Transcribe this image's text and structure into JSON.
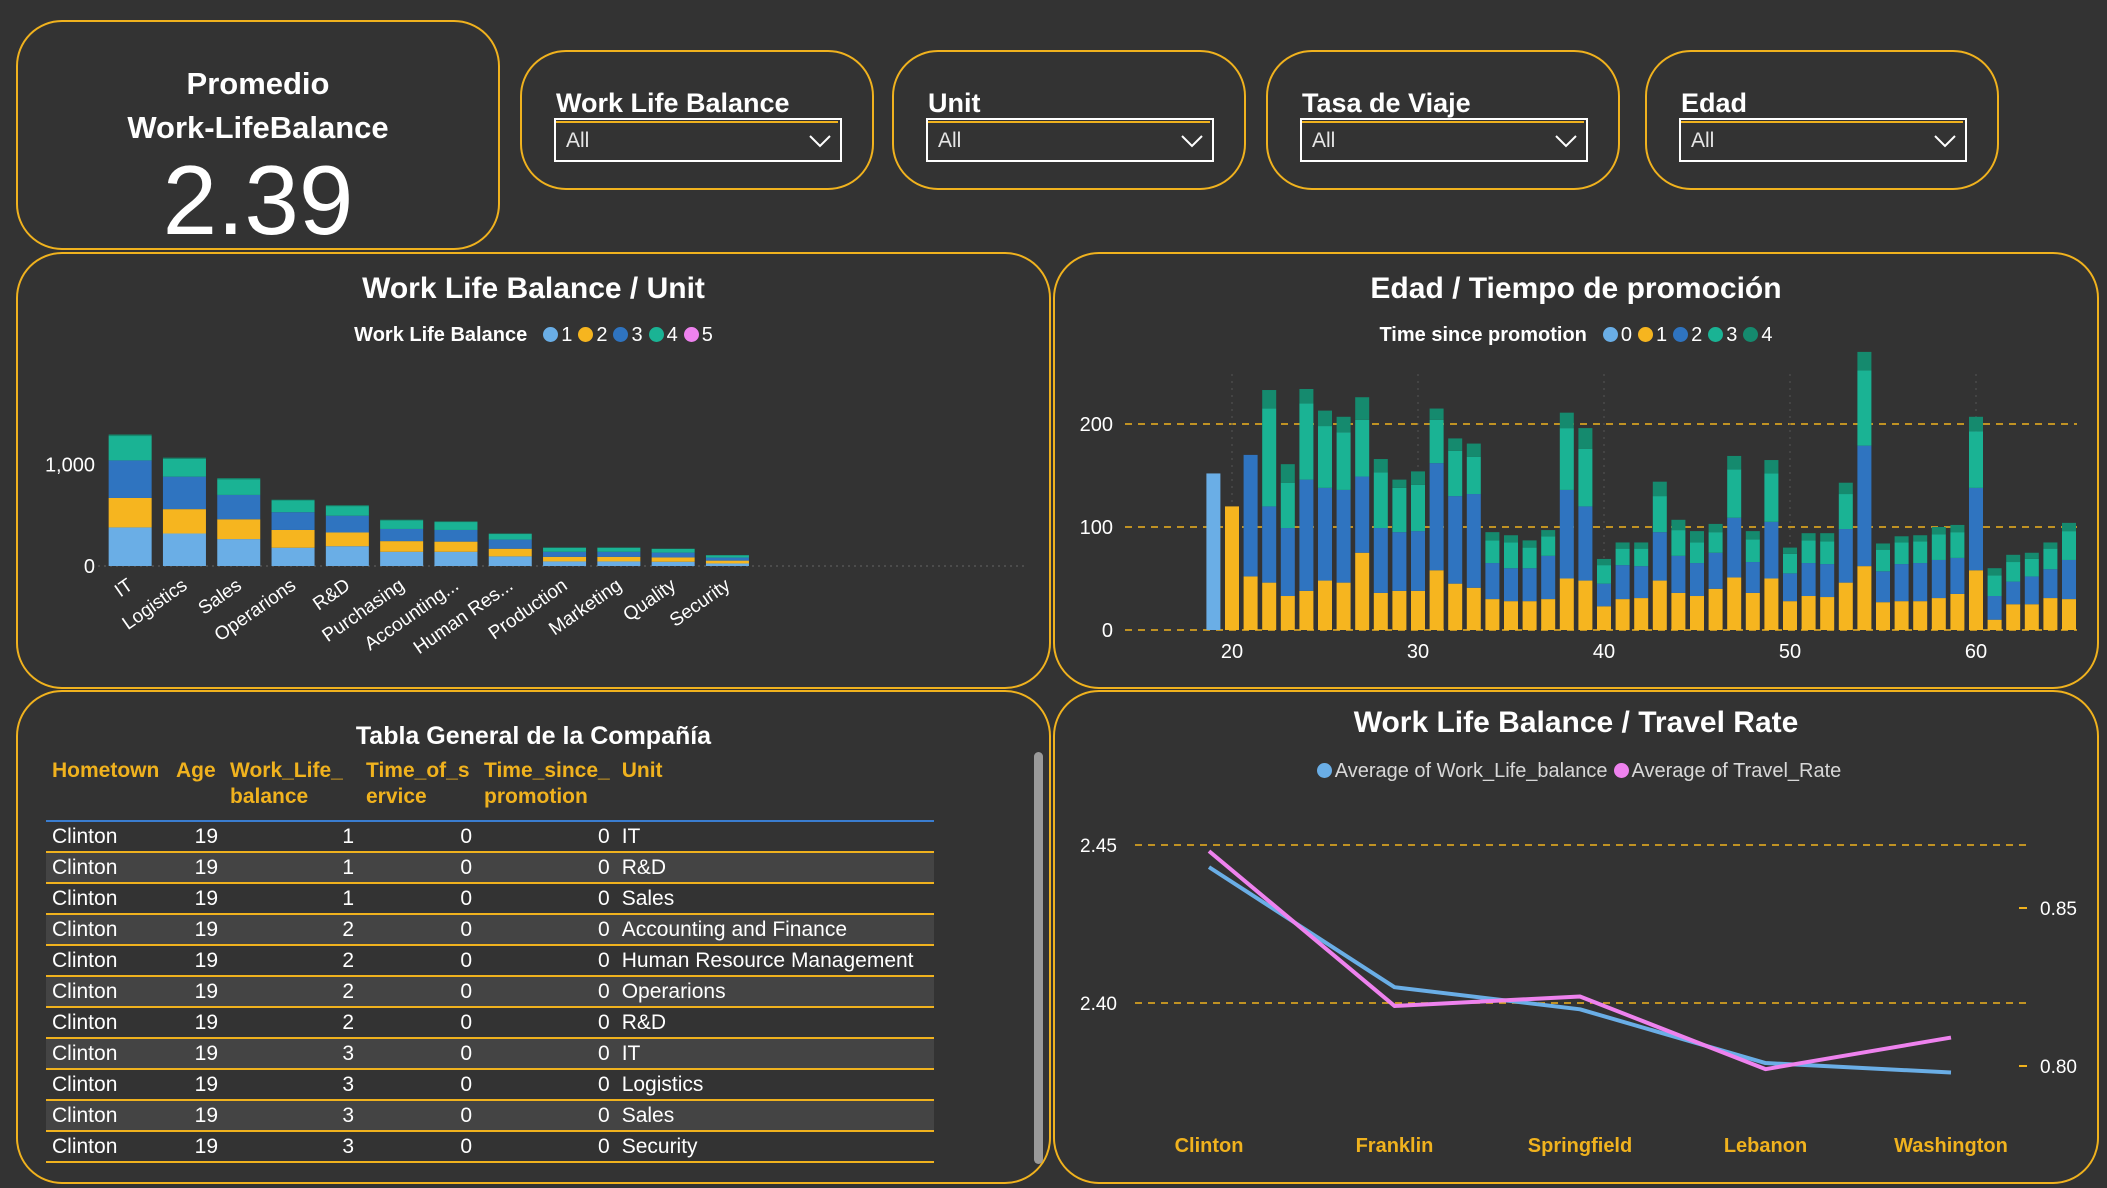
{
  "kpi": {
    "title_line1": "Promedio",
    "title_line2": "Work-LifeBalance",
    "value": "2.39"
  },
  "slicers": [
    {
      "label": "Work Life Balance",
      "value": "All"
    },
    {
      "label": "Unit",
      "value": "All"
    },
    {
      "label": "Tasa de Viaje",
      "value": "All"
    },
    {
      "label": "Edad",
      "value": "All"
    }
  ],
  "colors": {
    "accent": "#f0b21e",
    "s0": "#6aaee6",
    "s1": "#f6b51f",
    "s2": "#2f74c0",
    "s3": "#1ab394",
    "s4": "#158a6e",
    "s5": "#ee82ee",
    "wlb_line": "#6aaee6",
    "travel_line": "#ee82ee"
  },
  "wlb_unit": {
    "title": "Work Life Balance / Unit",
    "legend_title": "Work Life Balance",
    "legend": [
      "1",
      "2",
      "3",
      "4",
      "5"
    ],
    "chart_data": {
      "type": "bar",
      "stacked": true,
      "categories": [
        "IT",
        "Logistics",
        "Sales",
        "Operarions",
        "R&D",
        "Purchasing",
        "Accounting...",
        "Human Res...",
        "Production",
        "Marketing",
        "Quality",
        "Security"
      ],
      "series": [
        {
          "name": "1",
          "values": [
            380,
            320,
            265,
            180,
            195,
            140,
            140,
            95,
            45,
            45,
            42,
            25
          ]
        },
        {
          "name": "2",
          "values": [
            290,
            240,
            195,
            175,
            135,
            105,
            100,
            75,
            45,
            45,
            42,
            28
          ]
        },
        {
          "name": "3",
          "values": [
            370,
            320,
            240,
            175,
            165,
            120,
            115,
            90,
            50,
            50,
            48,
            30
          ]
        },
        {
          "name": "4",
          "values": [
            240,
            175,
            155,
            115,
            95,
            85,
            78,
            55,
            40,
            40,
            36,
            22
          ]
        },
        {
          "name": "5",
          "values": [
            15,
            12,
            10,
            8,
            8,
            6,
            6,
            5,
            3,
            3,
            3,
            3
          ]
        }
      ],
      "y_ticks": [
        "0",
        "1,000"
      ],
      "ylim": [
        0,
        1300
      ],
      "grid": false
    }
  },
  "age_promo": {
    "title": "Edad / Tiempo de promoción",
    "legend_title": "Time since promotion",
    "legend": [
      "0",
      "1",
      "2",
      "3",
      "4"
    ],
    "chart_data": {
      "type": "bar",
      "stacked": true,
      "x_ticks": [
        "20",
        "30",
        "40",
        "50",
        "60"
      ],
      "y_ticks": [
        "0",
        "100",
        "200"
      ],
      "ylim": [
        0,
        240
      ],
      "categories": [
        19,
        20,
        21,
        22,
        23,
        24,
        25,
        26,
        27,
        28,
        29,
        30,
        31,
        32,
        33,
        34,
        35,
        36,
        37,
        38,
        39,
        40,
        41,
        42,
        43,
        44,
        45,
        46,
        47,
        48,
        49,
        50,
        51,
        52,
        53,
        54,
        55,
        56,
        57,
        58,
        59,
        60,
        61,
        62,
        63,
        64,
        65
      ],
      "series": [
        {
          "name": "0",
          "values": [
            152,
            0,
            0,
            0,
            0,
            0,
            0,
            0,
            0,
            0,
            0,
            0,
            0,
            0,
            0,
            0,
            0,
            0,
            0,
            0,
            0,
            0,
            0,
            0,
            0,
            0,
            0,
            0,
            0,
            0,
            0,
            0,
            0,
            0,
            0,
            0,
            0,
            0,
            0,
            0,
            0,
            0,
            0,
            0,
            0,
            0,
            0
          ]
        },
        {
          "name": "1",
          "values": [
            0,
            120,
            52,
            46,
            33,
            38,
            48,
            46,
            75,
            36,
            38,
            38,
            58,
            45,
            41,
            30,
            28,
            28,
            30,
            50,
            48,
            23,
            30,
            31,
            48,
            36,
            33,
            40,
            51,
            36,
            50,
            28,
            33,
            32,
            46,
            62,
            27,
            28,
            28,
            31,
            35,
            58,
            10,
            25,
            25,
            31,
            30
          ]
        },
        {
          "name": "2",
          "values": [
            0,
            0,
            118,
            74,
            66,
            108,
            90,
            90,
            74,
            63,
            57,
            58,
            104,
            85,
            91,
            35,
            32,
            32,
            42,
            86,
            72,
            22,
            33,
            31,
            47,
            36,
            32,
            35,
            58,
            30,
            55,
            27,
            32,
            32,
            52,
            117,
            30,
            36,
            37,
            37,
            35,
            80,
            23,
            22,
            27,
            28,
            38
          ]
        },
        {
          "name": "3",
          "values": [
            0,
            0,
            0,
            95,
            44,
            74,
            60,
            56,
            55,
            54,
            43,
            45,
            42,
            44,
            36,
            22,
            25,
            20,
            19,
            60,
            56,
            18,
            16,
            17,
            35,
            25,
            20,
            20,
            47,
            22,
            47,
            19,
            22,
            22,
            34,
            73,
            21,
            21,
            21,
            25,
            25,
            55,
            20,
            19,
            17,
            20,
            28
          ]
        },
        {
          "name": "4",
          "values": [
            0,
            0,
            0,
            18,
            18,
            14,
            15,
            15,
            22,
            13,
            8,
            13,
            11,
            12,
            13,
            8,
            7,
            7,
            6,
            15,
            20,
            6,
            6,
            6,
            14,
            10,
            11,
            8,
            13,
            8,
            13,
            6,
            7,
            8,
            11,
            18,
            6,
            6,
            6,
            7,
            7,
            14,
            7,
            7,
            6,
            6,
            8
          ]
        }
      ],
      "grid": true
    }
  },
  "table": {
    "title": "Tabla General de la Compañía",
    "headers": [
      {
        "line1": "Hometown",
        "line2": ""
      },
      {
        "line1": "Age",
        "line2": ""
      },
      {
        "line1": "Work_Life_",
        "line2": "balance"
      },
      {
        "line1": "Time_of_s",
        "line2": "ervice"
      },
      {
        "line1": "Time_since_",
        "line2": "promotion"
      },
      {
        "line1": "Unit",
        "line2": ""
      }
    ],
    "rows": [
      [
        "Clinton",
        "19",
        "1",
        "0",
        "0",
        "IT"
      ],
      [
        "Clinton",
        "19",
        "1",
        "0",
        "0",
        "R&D"
      ],
      [
        "Clinton",
        "19",
        "1",
        "0",
        "0",
        "Sales"
      ],
      [
        "Clinton",
        "19",
        "2",
        "0",
        "0",
        "Accounting and Finance"
      ],
      [
        "Clinton",
        "19",
        "2",
        "0",
        "0",
        "Human Resource Management"
      ],
      [
        "Clinton",
        "19",
        "2",
        "0",
        "0",
        "Operarions"
      ],
      [
        "Clinton",
        "19",
        "2",
        "0",
        "0",
        "R&D"
      ],
      [
        "Clinton",
        "19",
        "3",
        "0",
        "0",
        "IT"
      ],
      [
        "Clinton",
        "19",
        "3",
        "0",
        "0",
        "Logistics"
      ],
      [
        "Clinton",
        "19",
        "3",
        "0",
        "0",
        "Sales"
      ],
      [
        "Clinton",
        "19",
        "3",
        "0",
        "0",
        "Security"
      ]
    ]
  },
  "wlb_travel": {
    "title": "Work Life Balance / Travel Rate",
    "legend": [
      "Average of Work_Life_balance",
      "Average of Travel_Rate"
    ],
    "chart_data": {
      "type": "line",
      "categories": [
        "Clinton",
        "Franklin",
        "Springfield",
        "Lebanon",
        "Washington"
      ],
      "series": [
        {
          "name": "Average of Work_Life_balance",
          "axis": "left",
          "values": [
            2.443,
            2.405,
            2.398,
            2.381,
            2.378
          ]
        },
        {
          "name": "Average of Travel_Rate",
          "axis": "right",
          "values": [
            0.868,
            0.819,
            0.822,
            0.799,
            0.809
          ]
        }
      ],
      "y_left_ticks": [
        "2.40",
        "2.45"
      ],
      "y_right_ticks": [
        "0.80",
        "0.85"
      ],
      "y_left_range": [
        2.372,
        2.455
      ],
      "y_right_range": [
        0.7835,
        0.8735
      ],
      "grid": true
    }
  }
}
